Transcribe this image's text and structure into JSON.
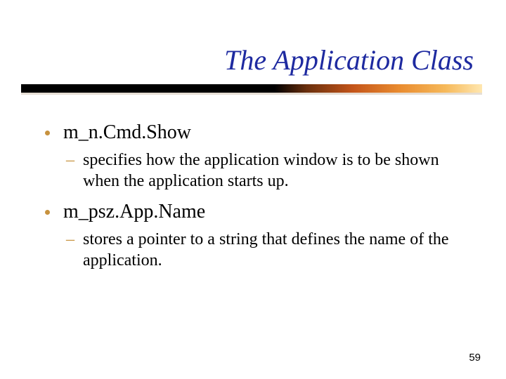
{
  "title": "The Application Class",
  "bullets": [
    {
      "label": "m_n.Cmd.Show",
      "sub": "specifies how the application window is to be shown when the application starts up."
    },
    {
      "label": "m_psz.App.Name",
      "sub": "stores a pointer to a  string that defines the name of the application."
    }
  ],
  "page_number": "59"
}
